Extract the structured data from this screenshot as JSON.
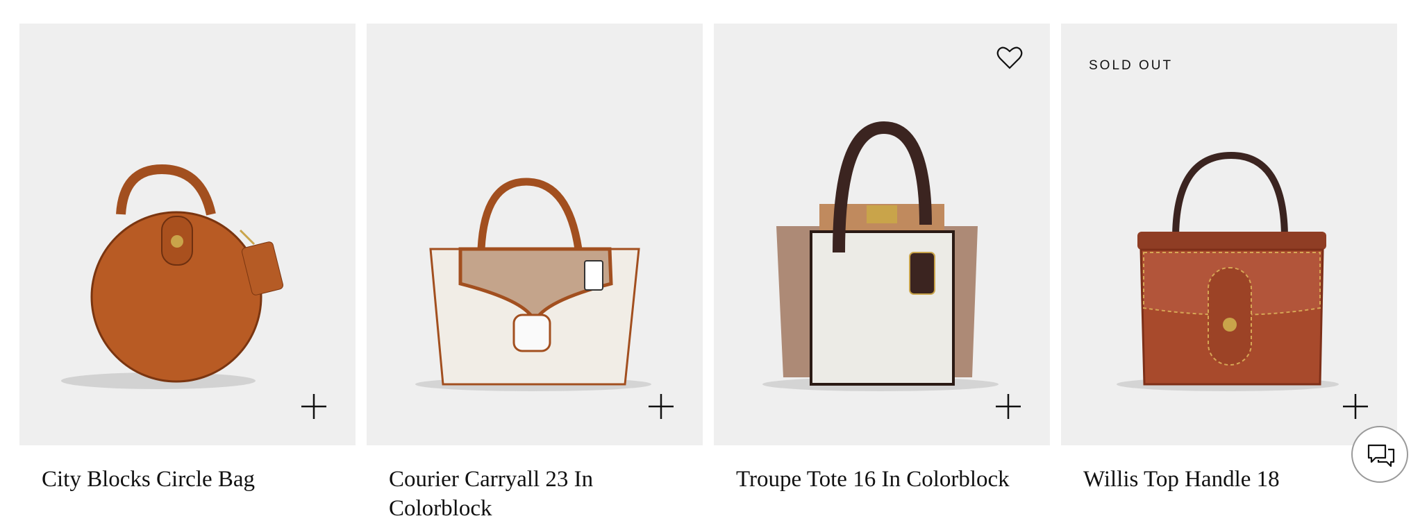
{
  "products": [
    {
      "name": "City Blocks Circle Bag",
      "badge": ""
    },
    {
      "name": "Courier Carryall 23 In Colorblock",
      "badge": ""
    },
    {
      "name": "Troupe Tote 16 In Colorblock",
      "badge": "",
      "wishlisted": false
    },
    {
      "name": "Willis Top Handle 18",
      "badge": "SOLD OUT"
    }
  ],
  "icons": {
    "add": "plus-icon",
    "wishlist": "heart-icon",
    "chat": "chat-icon"
  },
  "colors": {
    "card_bg": "#efefef",
    "text": "#111111"
  }
}
